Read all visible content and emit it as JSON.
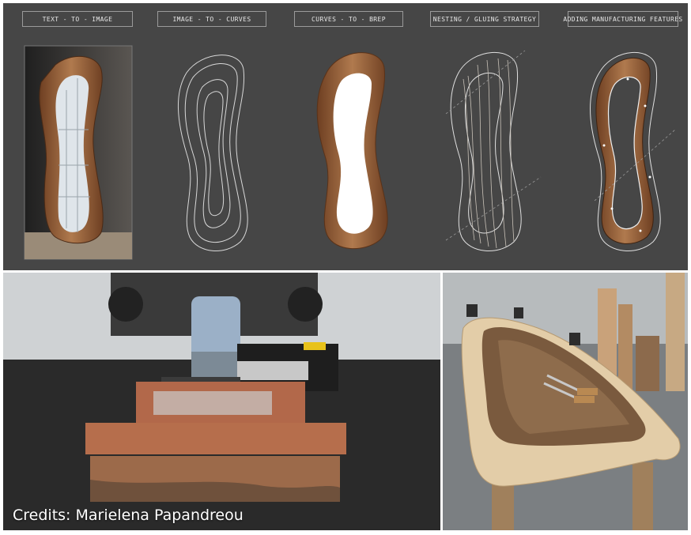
{
  "pipeline": {
    "stages": [
      {
        "label": "TEXT - TO - IMAGE"
      },
      {
        "label": "IMAGE - TO - CURVES"
      },
      {
        "label": "CURVES - TO - BREP"
      },
      {
        "label": "NESTING / GLUING STRATEGY"
      },
      {
        "label": "ADDING MANUFACTURING FEATURES"
      }
    ]
  },
  "photos": {
    "robot": {
      "credits": "Credits: Marielena Papandreou"
    }
  },
  "colors": {
    "panel_bg": "#464646",
    "wood": "#8a5a36",
    "line": "#d8d8d8"
  }
}
